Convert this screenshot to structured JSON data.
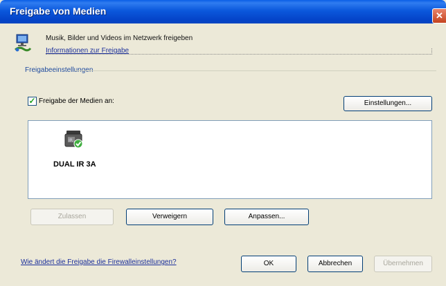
{
  "window": {
    "title": "Freigabe von Medien",
    "close_icon": "close-icon"
  },
  "header": {
    "icon": "network-sharing-icon",
    "description": "Musik, Bilder und Videos im Netzwerk freigeben",
    "info_link": "Informationen zur Freigabe"
  },
  "settings_group": {
    "title": "Freigabeeinstellungen",
    "share_checkbox": {
      "label": "Freigabe der Medien an:",
      "checked": true
    },
    "settings_button": "Einstellungen..."
  },
  "devices": [
    {
      "name": "DUAL IR 3A",
      "icon": "media-device-allowed-icon"
    }
  ],
  "device_actions": {
    "allow": "Zulassen",
    "deny": "Verweigern",
    "customize": "Anpassen..."
  },
  "footer": {
    "firewall_link": "Wie ändert die Freigabe die Firewalleinstellungen?",
    "ok": "OK",
    "cancel": "Abbrechen",
    "apply": "Übernehmen"
  }
}
